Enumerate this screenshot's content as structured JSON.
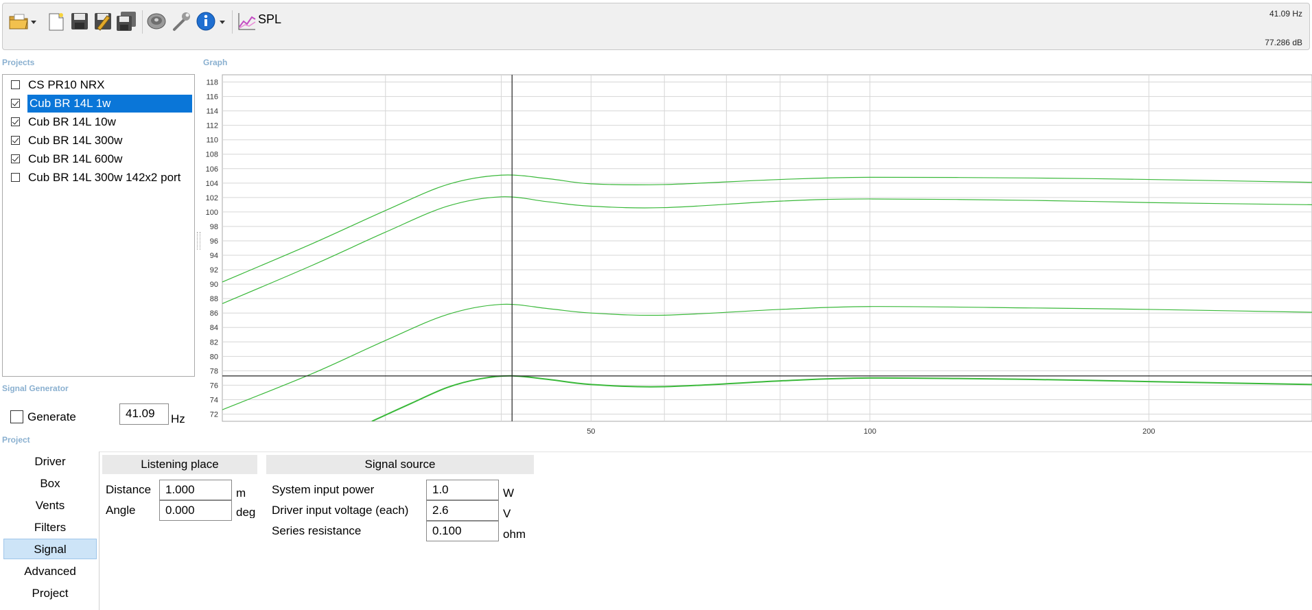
{
  "toolbar": {
    "icons": [
      "open-folder-icon",
      "new-file-icon",
      "save-icon",
      "save-edit-icon",
      "save-all-icon",
      "speaker-icon",
      "wrench-icon",
      "info-icon",
      "spl-chart-icon"
    ],
    "spl_label": "SPL",
    "readout_freq": "41.09 Hz",
    "readout_db": "77.286 dB"
  },
  "projects": {
    "section_label": "Projects",
    "items": [
      {
        "label": "CS PR10 NRX",
        "checked": false,
        "selected": false
      },
      {
        "label": "Cub BR 14L 1w",
        "checked": true,
        "selected": true
      },
      {
        "label": "Cub BR 14L 10w",
        "checked": true,
        "selected": false
      },
      {
        "label": "Cub BR 14L 300w",
        "checked": true,
        "selected": false
      },
      {
        "label": "Cub BR 14L 600w",
        "checked": true,
        "selected": false
      },
      {
        "label": "Cub BR 14L 300w 142x2 port",
        "checked": false,
        "selected": false
      }
    ]
  },
  "signal_generator": {
    "section_label": "Signal Generator",
    "generate_label": "Generate",
    "frequency_value": "41.09",
    "unit": "Hz"
  },
  "graph": {
    "section_label": "Graph",
    "cursor_x": 41.09,
    "cursor_y": 77.286
  },
  "chart_data": {
    "type": "line",
    "title": "",
    "xlabel": "",
    "ylabel": "",
    "x_scale": "log",
    "xlim": [
      20,
      300
    ],
    "ylim": [
      71,
      119
    ],
    "grid": true,
    "y_ticks": [
      72,
      74,
      76,
      78,
      80,
      82,
      84,
      86,
      88,
      90,
      92,
      94,
      96,
      98,
      100,
      102,
      104,
      106,
      108,
      110,
      112,
      114,
      116,
      118
    ],
    "x_ticks": [
      50,
      100,
      200
    ],
    "x_gridlines": [
      20,
      30,
      40,
      50,
      60,
      70,
      80,
      90,
      100,
      200,
      300
    ],
    "line_color": "#39b839",
    "series": [
      {
        "x": [
          20,
          25,
          30,
          35,
          40,
          45,
          50,
          60,
          80,
          100,
          150,
          200,
          300
        ],
        "y": [
          90.3,
          95.6,
          100.2,
          103.8,
          105.1,
          104.6,
          103.9,
          103.8,
          104.5,
          104.8,
          104.7,
          104.5,
          104.1
        ]
      },
      {
        "x": [
          20,
          25,
          30,
          35,
          40,
          45,
          50,
          60,
          80,
          100,
          150,
          200,
          300
        ],
        "y": [
          87.3,
          92.6,
          97.2,
          100.8,
          102.1,
          101.4,
          100.8,
          100.6,
          101.5,
          101.8,
          101.6,
          101.3,
          101.0
        ]
      },
      {
        "x": [
          20,
          25,
          30,
          35,
          40,
          45,
          50,
          60,
          80,
          100,
          150,
          200,
          300
        ],
        "y": [
          72.6,
          77.6,
          82.2,
          85.8,
          87.2,
          86.6,
          86.0,
          85.7,
          86.5,
          86.9,
          86.7,
          86.5,
          86.1
        ]
      },
      {
        "x": [
          29,
          32,
          35,
          38,
          41,
          45,
          50,
          60,
          80,
          100,
          150,
          200,
          300
        ],
        "y": [
          71.0,
          73.5,
          75.7,
          76.9,
          77.3,
          76.8,
          76.1,
          75.8,
          76.6,
          77.0,
          76.8,
          76.5,
          76.1
        ]
      }
    ]
  },
  "project_section": {
    "section_label": "Project",
    "nav": [
      "Driver",
      "Box",
      "Vents",
      "Filters",
      "Signal",
      "Advanced",
      "Project"
    ],
    "active_nav": "Signal",
    "listening_place": {
      "title": "Listening place",
      "distance_label": "Distance",
      "distance_value": "1.000",
      "distance_unit": "m",
      "angle_label": "Angle",
      "angle_value": "0.000",
      "angle_unit": "deg"
    },
    "signal_source": {
      "title": "Signal source",
      "power_label": "System input power",
      "power_value": "1.0",
      "power_unit": "W",
      "voltage_label": "Driver input voltage (each)",
      "voltage_value": "2.6",
      "voltage_unit": "V",
      "resistance_label": "Series resistance",
      "resistance_value": "0.100",
      "resistance_unit": "ohm"
    }
  }
}
